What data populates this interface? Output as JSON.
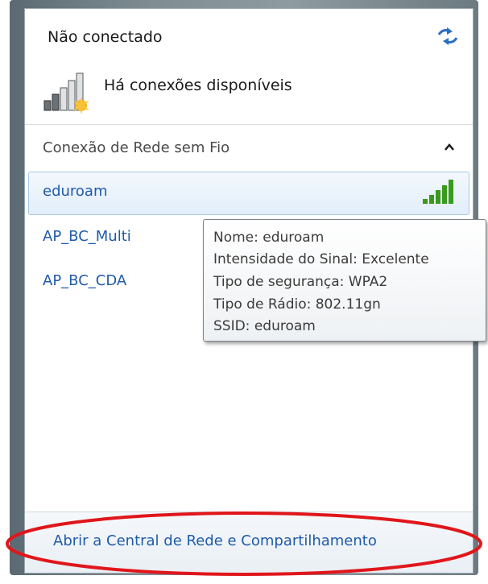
{
  "header": {
    "status": "Não conectado",
    "availability": "Há conexões disponíveis"
  },
  "section": {
    "label": "Conexão de Rede sem Fio"
  },
  "networks": [
    {
      "name": "eduroam",
      "selected": true
    },
    {
      "name": "AP_BC_Multi",
      "selected": false
    },
    {
      "name": "AP_BC_CDA",
      "selected": false
    }
  ],
  "tooltip": {
    "name_line": "Nome: eduroam",
    "signal_line": "Intensidade do Sinal: Excelente",
    "security_line": "Tipo de segurança: WPA2",
    "radio_line": "Tipo de Rádio: 802.11gn",
    "ssid_line": "SSID: eduroam"
  },
  "footer": {
    "link": "Abrir a Central de Rede e Compartilhamento"
  },
  "icons": {
    "refresh": "refresh-icon",
    "signal_status": "network-unavailable-signal-icon",
    "collapse": "chevron-up-icon",
    "signal_strength": "signal-strength-icon"
  },
  "colors": {
    "link": "#1f5ba9",
    "selected_bg": "#e2eef9",
    "signal_green": "#3a9a1e",
    "highlight_ring": "#e0161b"
  }
}
